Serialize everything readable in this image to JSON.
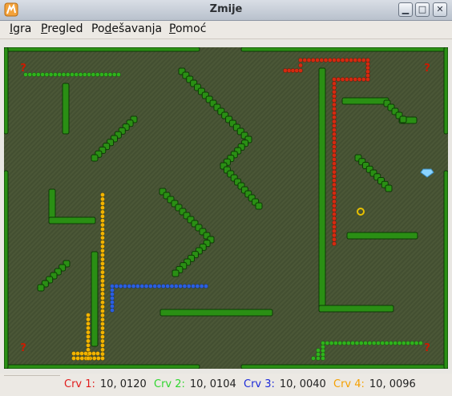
{
  "window": {
    "title": "Zmije"
  },
  "window_controls": {
    "minimize": "▁",
    "maximize": "□",
    "close": "✕"
  },
  "menu": [
    {
      "pre": "",
      "mnemonic": "I",
      "post": "gra"
    },
    {
      "pre": "",
      "mnemonic": "P",
      "post": "regled"
    },
    {
      "pre": "Po",
      "mnemonic": "d",
      "post": "ešavanja"
    },
    {
      "pre": "",
      "mnemonic": "P",
      "post": "omoć"
    }
  ],
  "status": {
    "worms": [
      {
        "label": "Crv 1:",
        "value": "10, 0120",
        "color": "#e01b1b"
      },
      {
        "label": "Crv 2:",
        "value": "10, 0104",
        "color": "#2fd62f"
      },
      {
        "label": "Crv 3:",
        "value": "10, 0040",
        "color": "#1c2ad8"
      },
      {
        "label": "Crv 4:",
        "value": "10, 0096",
        "color": "#f5a000"
      }
    ]
  },
  "colors": {
    "board_bg": "#4a5636",
    "wall": "#2a8f14",
    "snake_red": "#d42a10",
    "snake_green": "#2fb21c",
    "snake_blue": "#2b5fe0",
    "snake_yellow": "#f2b400",
    "bonus_question": "#cc1a00",
    "diamond": "#8ad4ff",
    "ring": "#e8c000"
  },
  "game": {
    "items": [
      {
        "kind": "question-bonus",
        "label": "?"
      },
      {
        "kind": "question-bonus",
        "label": "?"
      },
      {
        "kind": "question-bonus",
        "label": "?"
      },
      {
        "kind": "question-bonus",
        "label": "?"
      },
      {
        "kind": "diamond-bonus"
      },
      {
        "kind": "ring-bonus"
      }
    ]
  }
}
